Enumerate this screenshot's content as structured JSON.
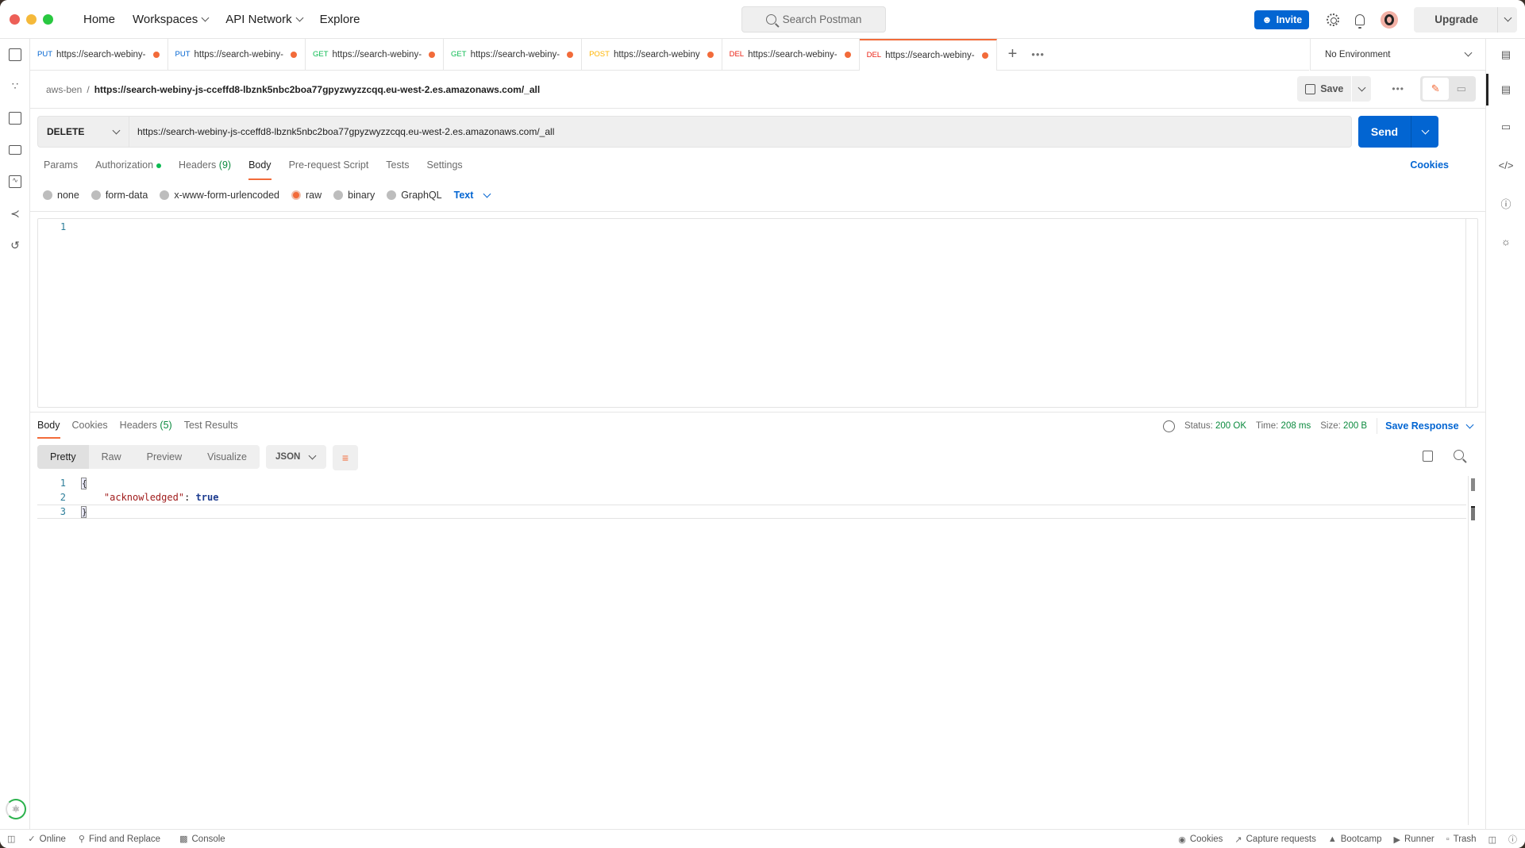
{
  "titlebar": {
    "nav": [
      {
        "label": "Home",
        "has_dropdown": false
      },
      {
        "label": "Workspaces",
        "has_dropdown": true
      },
      {
        "label": "API Network",
        "has_dropdown": true
      },
      {
        "label": "Explore",
        "has_dropdown": false
      }
    ],
    "search_placeholder": "Search Postman",
    "invite_label": "Invite",
    "upgrade_label": "Upgrade",
    "accent_color": "#f26b3a",
    "primary_color": "#0265d2"
  },
  "left_sidebar": {
    "icons": [
      "collections-icon",
      "apis-icon",
      "environments-icon",
      "mock-servers-icon",
      "monitors-icon",
      "flows-icon",
      "history-icon"
    ]
  },
  "right_sidebar": {
    "icons": [
      "environment-quick-look-icon",
      "documentation-icon",
      "comments-icon",
      "code-icon",
      "info-icon",
      "lightbulb-icon"
    ]
  },
  "tabs": [
    {
      "method": "PUT",
      "method_color": "#0265d2",
      "label": "https://search-webiny-",
      "unsaved": true,
      "active": false
    },
    {
      "method": "PUT",
      "method_color": "#0265d2",
      "label": "https://search-webiny-",
      "unsaved": true,
      "active": false
    },
    {
      "method": "GET",
      "method_color": "#0cbb52",
      "label": "https://search-webiny-",
      "unsaved": true,
      "active": false
    },
    {
      "method": "GET",
      "method_color": "#0cbb52",
      "label": "https://search-webiny-",
      "unsaved": true,
      "active": false
    },
    {
      "method": "POST",
      "method_color": "#ffb400",
      "label": "https://search-webiny",
      "unsaved": true,
      "active": false
    },
    {
      "method": "DEL",
      "method_color": "#eb2013",
      "label": "https://search-webiny-",
      "unsaved": true,
      "active": false
    },
    {
      "method": "DEL",
      "method_color": "#eb2013",
      "label": "https://search-webiny-",
      "unsaved": true,
      "active": true
    }
  ],
  "environment": {
    "selected": "No Environment"
  },
  "breadcrumb": {
    "workspace": "aws-ben",
    "separator": "/",
    "request": "https://search-webiny-js-cceffd8-lbznk5nbc2boa77gpyzwyzzcqq.eu-west-2.es.amazonaws.com/_all"
  },
  "request_actions": {
    "save_label": "Save"
  },
  "request": {
    "method": "DELETE",
    "url": "https://search-webiny-js-cceffd8-lbznk5nbc2boa77gpyzwyzzcqq.eu-west-2.es.amazonaws.com/_all",
    "send_label": "Send",
    "tabs": [
      {
        "label": "Params"
      },
      {
        "label": "Authorization",
        "indicator": true
      },
      {
        "label": "Headers",
        "count": "(9)"
      },
      {
        "label": "Body",
        "active": true
      },
      {
        "label": "Pre-request Script"
      },
      {
        "label": "Tests"
      },
      {
        "label": "Settings"
      }
    ],
    "cookies_label": "Cookies",
    "body_types": [
      {
        "label": "none",
        "selected": false
      },
      {
        "label": "form-data",
        "selected": false
      },
      {
        "label": "x-www-form-urlencoded",
        "selected": false
      },
      {
        "label": "raw",
        "selected": true
      },
      {
        "label": "binary",
        "selected": false
      },
      {
        "label": "GraphQL",
        "selected": false
      }
    ],
    "raw_format": "Text",
    "body_lines": [
      "1"
    ]
  },
  "response": {
    "tabs": [
      {
        "label": "Body",
        "active": true
      },
      {
        "label": "Cookies"
      },
      {
        "label": "Headers",
        "count": "(5)"
      },
      {
        "label": "Test Results"
      }
    ],
    "status_label": "Status:",
    "status": "200 OK",
    "time_label": "Time:",
    "time": "208 ms",
    "size_label": "Size:",
    "size": "200 B",
    "save_response_label": "Save Response",
    "view_modes": [
      {
        "label": "Pretty",
        "active": true
      },
      {
        "label": "Raw"
      },
      {
        "label": "Preview"
      },
      {
        "label": "Visualize"
      }
    ],
    "format": "JSON",
    "code": {
      "line_numbers": [
        "1",
        "2",
        "3"
      ],
      "open_brace": "{",
      "key": "\"acknowledged\"",
      "colon": ": ",
      "value": "true",
      "close_brace": "}"
    }
  },
  "statusbar": {
    "left": [
      {
        "label": "Online",
        "icon": "check-circle-icon"
      },
      {
        "label": "Find and Replace",
        "icon": "search-icon"
      },
      {
        "label": "Console",
        "icon": "console-icon"
      }
    ],
    "right": [
      {
        "label": "Cookies",
        "icon": "cookie-icon"
      },
      {
        "label": "Capture requests",
        "icon": "satellite-icon"
      },
      {
        "label": "Bootcamp",
        "icon": "graduation-cap-icon"
      },
      {
        "label": "Runner",
        "icon": "play-icon"
      },
      {
        "label": "Trash",
        "icon": "trash-icon"
      }
    ]
  }
}
